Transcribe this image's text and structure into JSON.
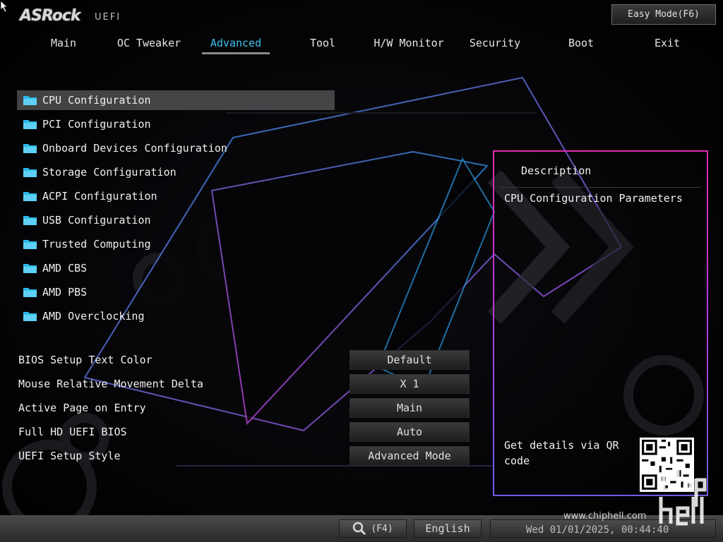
{
  "header": {
    "logo": "ASRock",
    "logo_suffix": "UEFI",
    "easy_mode_button": "Easy Mode(F6)"
  },
  "tabs": [
    {
      "label": "Main",
      "active": false
    },
    {
      "label": "OC Tweaker",
      "active": false
    },
    {
      "label": "Advanced",
      "active": true
    },
    {
      "label": "Tool",
      "active": false
    },
    {
      "label": "H/W Monitor",
      "active": false
    },
    {
      "label": "Security",
      "active": false
    },
    {
      "label": "Boot",
      "active": false
    },
    {
      "label": "Exit",
      "active": false
    }
  ],
  "menu": {
    "items": [
      {
        "label": "CPU Configuration",
        "selected": true,
        "icon": "folder-icon"
      },
      {
        "label": "PCI Configuration",
        "selected": false,
        "icon": "folder-icon"
      },
      {
        "label": "Onboard Devices Configuration",
        "selected": false,
        "icon": "folder-icon"
      },
      {
        "label": "Storage Configuration",
        "selected": false,
        "icon": "folder-icon"
      },
      {
        "label": "ACPI Configuration",
        "selected": false,
        "icon": "folder-icon"
      },
      {
        "label": "USB Configuration",
        "selected": false,
        "icon": "folder-icon"
      },
      {
        "label": "Trusted Computing",
        "selected": false,
        "icon": "folder-icon"
      },
      {
        "label": "AMD CBS",
        "selected": false,
        "icon": "folder-icon"
      },
      {
        "label": "AMD PBS",
        "selected": false,
        "icon": "folder-icon"
      },
      {
        "label": "AMD Overclocking",
        "selected": false,
        "icon": "folder-icon"
      }
    ]
  },
  "settings": [
    {
      "label": "BIOS Setup Text Color",
      "value": "Default"
    },
    {
      "label": "Mouse Relative Movement Delta",
      "value": "X 1"
    },
    {
      "label": "Active Page on Entry",
      "value": "Main"
    },
    {
      "label": "Full HD UEFI BIOS",
      "value": "Auto"
    },
    {
      "label": "UEFI Setup Style",
      "value": "Advanced Mode"
    }
  ],
  "description": {
    "title": "Description",
    "text": "CPU Configuration Parameters",
    "qr_text": "Get details via QR code"
  },
  "footer": {
    "search_key": "(F4)",
    "language": "English",
    "datetime": "Wed 01/01/2025, 00:44:40",
    "watermark": "www.chiphell.com"
  },
  "colors": {
    "accent": "#3ec3f0",
    "panel_border_top": "#e02bb0",
    "panel_border_bottom": "#6a5de6",
    "folder": "#2bb6ea"
  }
}
